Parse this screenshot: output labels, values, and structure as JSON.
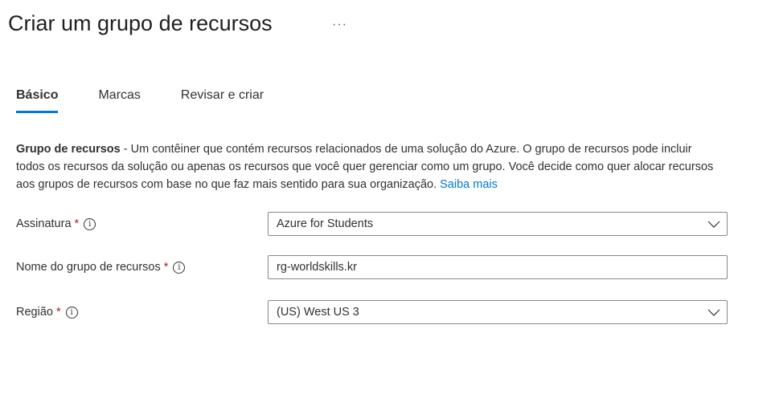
{
  "header": {
    "title": "Criar um grupo de recursos",
    "more_label": "···"
  },
  "tabs": [
    {
      "label": "Básico"
    },
    {
      "label": "Marcas"
    },
    {
      "label": "Revisar e criar"
    }
  ],
  "description": {
    "bold": "Grupo de recursos",
    "text": " - Um contêiner que contém recursos relacionados de uma solução do Azure. O grupo de recursos pode incluir todos os recursos da solução ou apenas os recursos que você quer gerenciar como um grupo. Você decide como quer alocar recursos aos grupos de recursos com base no que faz mais sentido para sua organização.",
    "link": "Saiba mais"
  },
  "form": {
    "subscription": {
      "label": "Assinatura",
      "required": "*",
      "info": "i",
      "value": "Azure for Students"
    },
    "name": {
      "label": "Nome do grupo de recursos",
      "required": "*",
      "info": "i",
      "value": "rg-worldskills.kr"
    },
    "region": {
      "label": "Região",
      "required": "*",
      "info": "i",
      "value": "(US) West US 3"
    }
  }
}
